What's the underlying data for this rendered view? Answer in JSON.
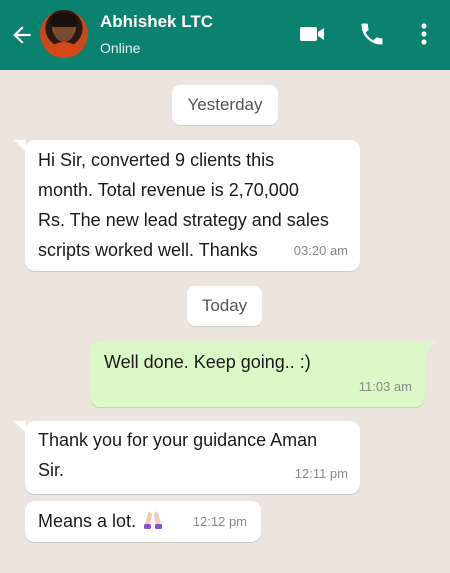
{
  "header": {
    "contact_name": "Abhishek LTC",
    "status": "Online",
    "icons": [
      "back-arrow-icon",
      "avatar",
      "video-call-icon",
      "phone-icon",
      "more-vertical-icon"
    ]
  },
  "colors": {
    "header": "#0b8170",
    "chat_bg": "#ece5dd",
    "incoming": "#ffffff",
    "outgoing": "#dcf8c6"
  },
  "dates": {
    "yesterday": "Yesterday",
    "today": "Today"
  },
  "messages": [
    {
      "direction": "incoming",
      "lines": [
        "Hi Sir, converted 9 clients this",
        "month. Total revenue is 2,70,000",
        "Rs. The new lead strategy and sales",
        "scripts worked well. Thanks"
      ],
      "time": "03:20 am"
    },
    {
      "direction": "outgoing",
      "lines": [
        "Well done. Keep going.. :)"
      ],
      "time": "11:03 am"
    },
    {
      "direction": "incoming",
      "lines": [
        "Thank you for your guidance Aman",
        "Sir."
      ],
      "time": "12:11 pm"
    },
    {
      "direction": "incoming",
      "lines": [
        "Means a lot."
      ],
      "emoji": "folded-hands-emoji",
      "time": "12:12 pm"
    }
  ]
}
